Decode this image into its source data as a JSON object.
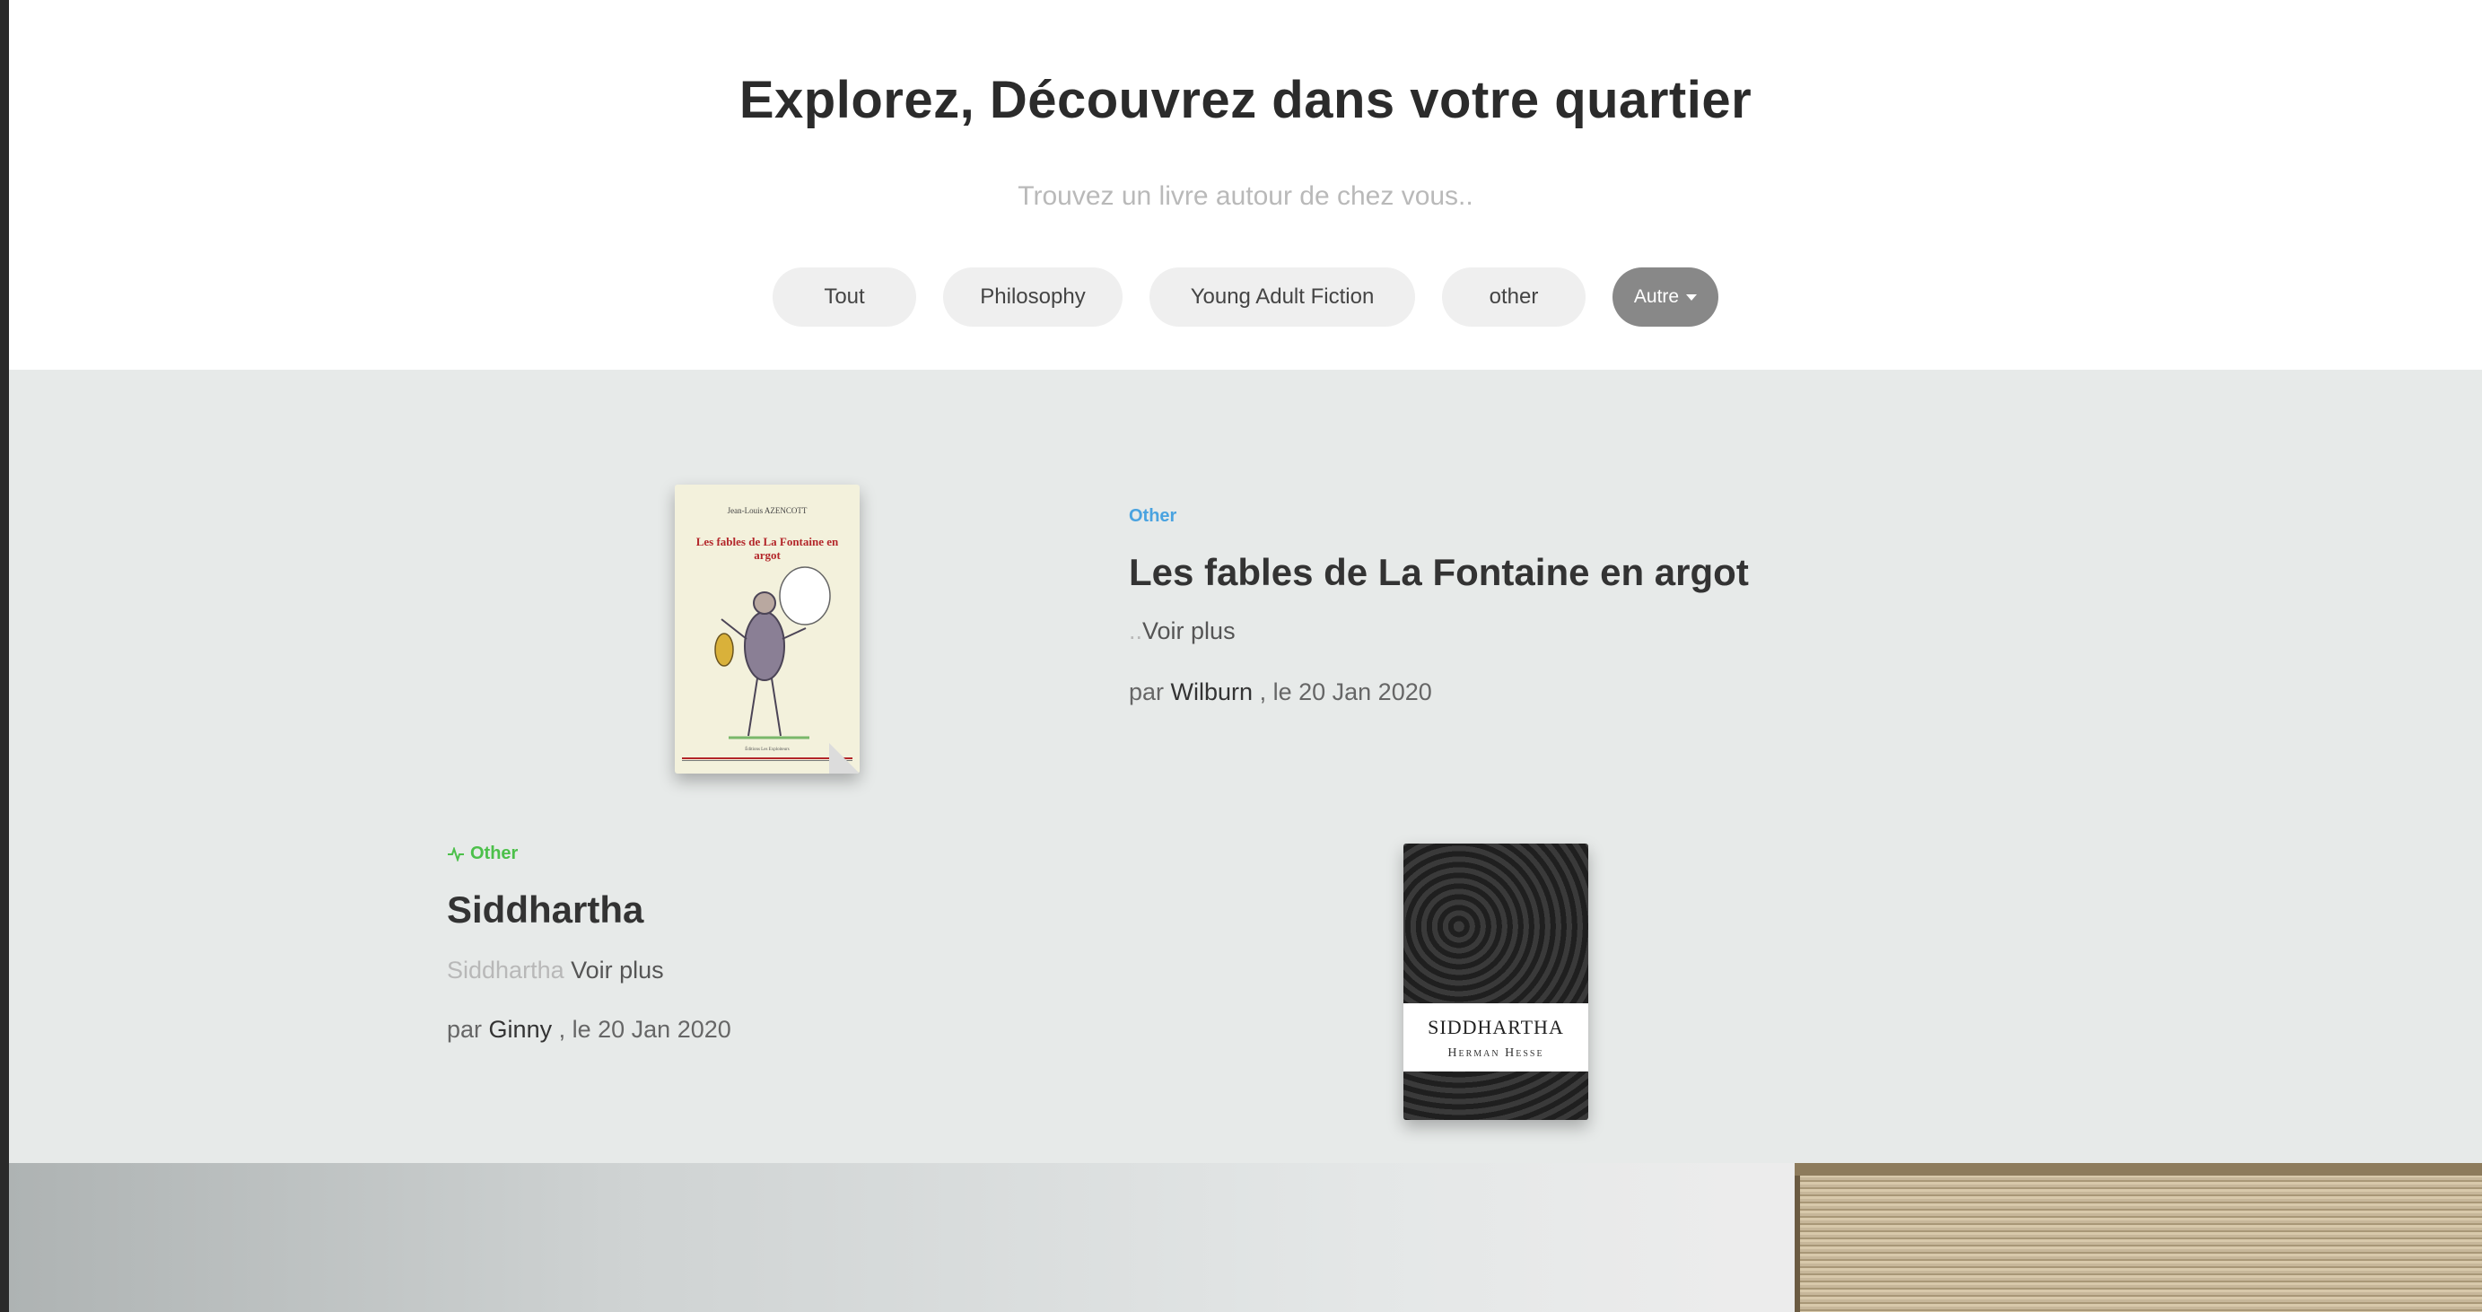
{
  "hero": {
    "title": "Explorez, Découvrez dans votre quartier",
    "subtitle": "Trouvez un livre autour de chez vous.."
  },
  "filters": {
    "items": [
      "Tout",
      "Philosophy",
      "Young Adult Fiction",
      "other"
    ],
    "dropdown_label": "Autre"
  },
  "posts": [
    {
      "category": "Other",
      "title": "Les fables de La Fontaine en argot",
      "excerpt_prefix": "..",
      "more_label": "Voir plus",
      "by_label": "par",
      "author": "Wilburn",
      "date_text": ", le 20 Jan 2020",
      "cover": {
        "author": "Jean-Louis AZENCOTT",
        "title": "Les fables de La Fontaine en argot",
        "publisher": "Éditions Les Exploiteurs"
      }
    },
    {
      "category": "Other",
      "title": "Siddhartha",
      "excerpt_prefix": "Siddhartha",
      "more_label": "Voir plus",
      "by_label": "par",
      "author": "Ginny",
      "date_text": ", le 20 Jan 2020",
      "cover": {
        "title": "SIDDHARTHA",
        "author": "Herman Hesse"
      }
    }
  ],
  "colors": {
    "category_blue": "#4aa3e0",
    "category_green": "#4cc04a",
    "feed_background": "#e7eae9",
    "dropdown_background": "#888888"
  }
}
